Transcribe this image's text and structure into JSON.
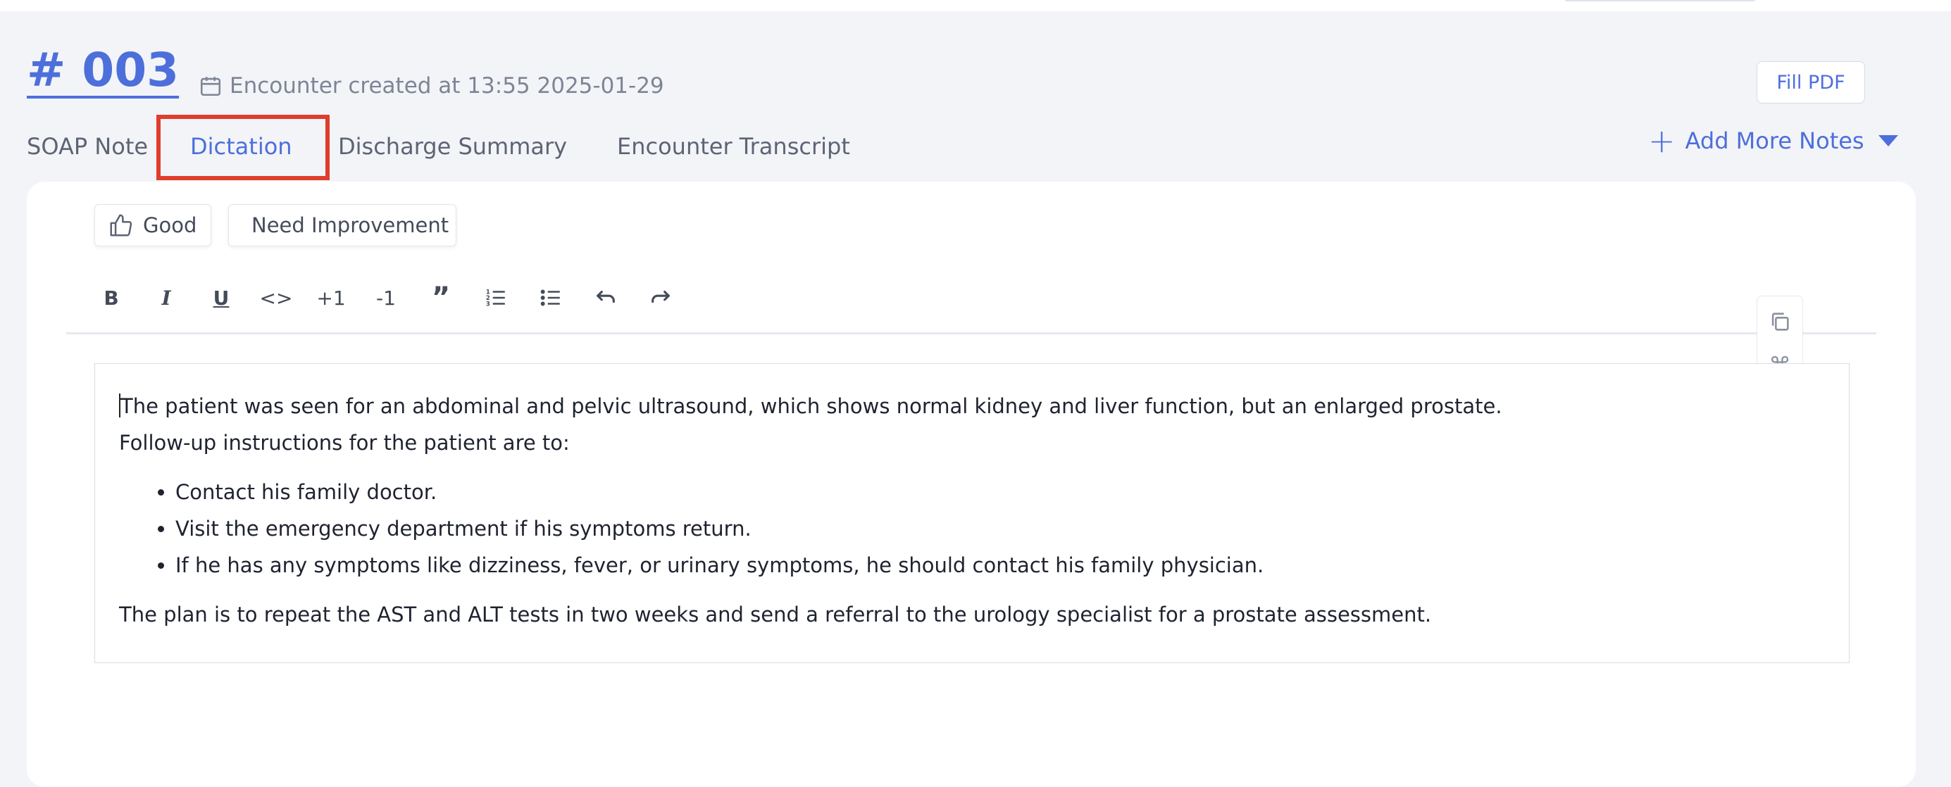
{
  "encounter": {
    "id": "# 003",
    "created_text": "Encounter created at 13:55 2025-01-29"
  },
  "actions": {
    "fill_pdf": "Fill PDF",
    "add_more_notes": "Add More Notes"
  },
  "tabs": [
    {
      "label": "SOAP Note",
      "active": false
    },
    {
      "label": "Dictation",
      "active": true
    },
    {
      "label": "Discharge Summary",
      "active": false
    },
    {
      "label": "Encounter Transcript",
      "active": false
    }
  ],
  "feedback": {
    "good": "Good",
    "need_improvement": "Need Improvement"
  },
  "toolbar": {
    "bold": "B",
    "italic": "I",
    "underline": "U",
    "code": "<>",
    "indent": "+1",
    "outdent": "-1",
    "quote": "”"
  },
  "icons": {
    "calendar": "calendar-icon",
    "thumbs_up": "thumbs-up-icon",
    "copy": "copy-icon",
    "command": "command-icon"
  },
  "colors": {
    "accent": "#4d6fdb",
    "tab_highlight": "#e03d2c",
    "background": "#f3f4f8"
  },
  "editor": {
    "paragraph1": "The patient was seen for an abdominal and pelvic ultrasound, which shows normal kidney and liver function, but an enlarged prostate.",
    "paragraph2": "Follow-up instructions for the patient are to:",
    "bullets": [
      "Contact his family doctor.",
      "Visit the emergency department if his symptoms return.",
      "If he has any symptoms like dizziness, fever, or urinary symptoms, he should contact his family physician."
    ],
    "paragraph3": "The plan is to repeat the AST and ALT tests in two weeks and send a referral to the urology specialist for a prostate assessment."
  }
}
